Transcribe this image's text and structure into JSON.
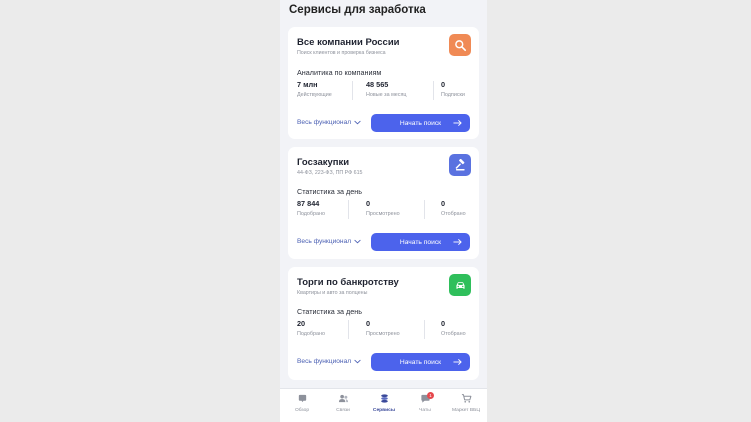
{
  "screen": {
    "title": "Сервисы для заработка"
  },
  "colors": {
    "accent": "#4c63ec",
    "link": "#4a5fb3",
    "icon_orange": "#f08a55",
    "icon_blue": "#5a72e0",
    "icon_green": "#2fbf5b",
    "badge": "#e5484d"
  },
  "cards": [
    {
      "title": "Все компании России",
      "subtitle": "Поиск клиентов и проверка бизнеса",
      "icon": "search-icon",
      "stats_title": "Аналитика по компаниям",
      "stats": [
        {
          "value": "7 млн",
          "caption": "Действующие"
        },
        {
          "value": "48 565",
          "caption": "Новые за месяц"
        },
        {
          "value": "0",
          "caption": "Подписки"
        }
      ],
      "more_label": "Весь функционал",
      "action_label": "Начать поиск"
    },
    {
      "title": "Госзакупки",
      "subtitle": "44-ФЗ, 223-ФЗ, ПП РФ 615",
      "icon": "gavel-icon",
      "stats_title": "Статистика за день",
      "stats": [
        {
          "value": "87 844",
          "caption": "Подобрано"
        },
        {
          "value": "0",
          "caption": "Просмотрено"
        },
        {
          "value": "0",
          "caption": "Отобрано"
        }
      ],
      "more_label": "Весь функционал",
      "action_label": "Начать поиск"
    },
    {
      "title": "Торги по банкротству",
      "subtitle": "Квартиры и авто за полцены",
      "icon": "car-icon",
      "stats_title": "Статистика за день",
      "stats": [
        {
          "value": "20",
          "caption": "Подобрано"
        },
        {
          "value": "0",
          "caption": "Просмотрено"
        },
        {
          "value": "0",
          "caption": "Отобрано"
        }
      ],
      "more_label": "Весь функционал",
      "action_label": "Начать поиск"
    }
  ],
  "tabbar": [
    {
      "label": "Обзор",
      "icon": "home-icon",
      "active": false
    },
    {
      "label": "Связи",
      "icon": "contacts-icon",
      "active": false
    },
    {
      "label": "Сервисы",
      "icon": "services-icon",
      "active": true
    },
    {
      "label": "Чаты",
      "icon": "chat-icon",
      "active": false,
      "badge": "1"
    },
    {
      "label": "Маркет ВБЦ",
      "icon": "cart-icon",
      "active": false
    }
  ]
}
